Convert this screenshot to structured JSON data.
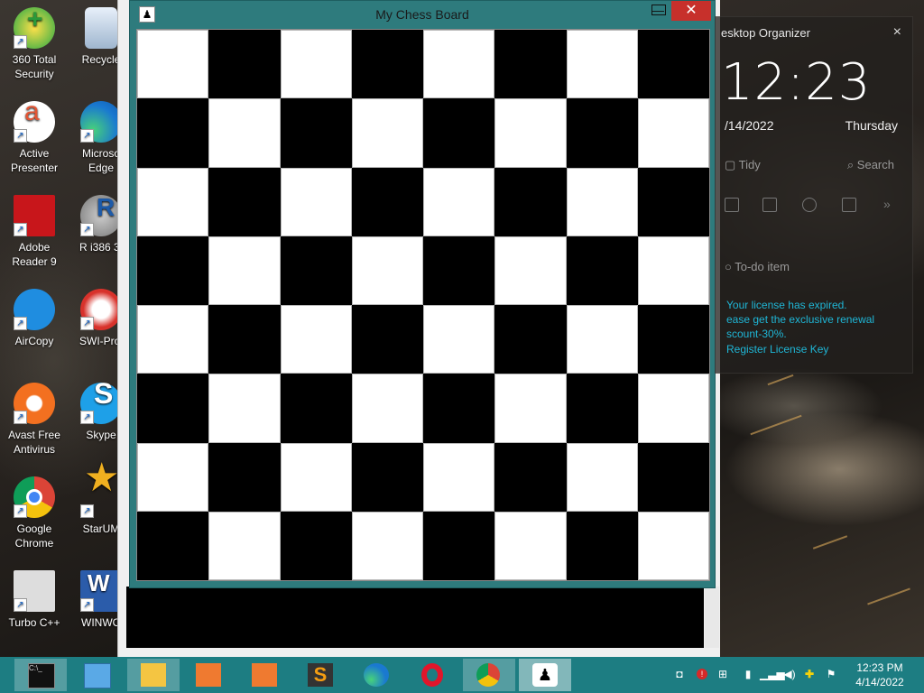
{
  "desktop_icons": [
    {
      "id": "360",
      "label": "360 Total Security"
    },
    {
      "id": "recycle",
      "label": "Recycle"
    },
    {
      "id": "active-presenter",
      "label": "Active Presenter"
    },
    {
      "id": "edge",
      "label": "Microso Edge"
    },
    {
      "id": "adobe",
      "label": "Adobe Reader 9"
    },
    {
      "id": "r386",
      "label": "R i386 3."
    },
    {
      "id": "aircopy",
      "label": "AirCopy"
    },
    {
      "id": "swi-prolog",
      "label": "SWI-Prol"
    },
    {
      "id": "avast",
      "label": "Avast Free Antivirus"
    },
    {
      "id": "skype",
      "label": "Skype"
    },
    {
      "id": "chrome",
      "label": "Google Chrome"
    },
    {
      "id": "staruml",
      "label": "StarUM"
    },
    {
      "id": "turboc",
      "label": "Turbo C++"
    },
    {
      "id": "winword",
      "label": "WINWO"
    }
  ],
  "chess_window": {
    "title": "My Chess Board",
    "minimize": "—",
    "close": "✕",
    "board": {
      "rows": 8,
      "cols": 8,
      "top_left": "light",
      "dark_color": "#000000",
      "light_color": "#ffffff"
    }
  },
  "organizer": {
    "title": "esktop Organizer",
    "close": "×",
    "time": "12:23",
    "date": "/14/2022",
    "day": "Thursday",
    "tidy": "Tidy",
    "search": "Search",
    "todo": "To-do item",
    "license_line1": "Your license has expired.",
    "license_line2": "ease get the exclusive renewal",
    "license_line3": "scount-30%.",
    "register": "Register License Key"
  },
  "taskbar": {
    "apps": [
      "cmd",
      "control-panel",
      "file-explorer",
      "active-presenter",
      "camera",
      "sublime-text",
      "edge",
      "opera",
      "chrome",
      "java"
    ],
    "active_app": "java",
    "clock_time": "12:23 PM",
    "clock_date": "4/14/2022",
    "accent": "#1d7d82"
  }
}
